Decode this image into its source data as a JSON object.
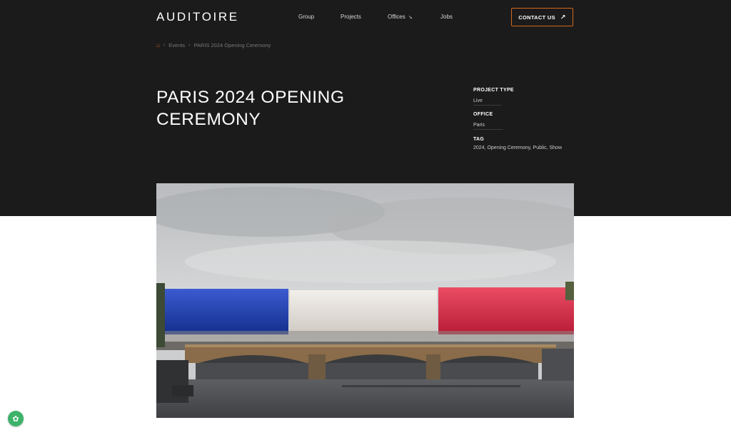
{
  "brand": {
    "logo": "AUDITOIRE"
  },
  "nav": {
    "items": [
      {
        "label": "Group"
      },
      {
        "label": "Projects"
      },
      {
        "label": "Offices",
        "icon": "arrow-down-right-icon"
      },
      {
        "label": "Jobs"
      }
    ],
    "contact_label": "CONTACT US",
    "contact_icon": "arrow-up-right-icon",
    "accent_color": "#d0681f"
  },
  "breadcrumb": {
    "home_icon": "home-icon",
    "items": [
      "Events",
      "PARIS 2024 Opening Ceremony"
    ]
  },
  "page": {
    "title": "PARIS 2024 OPENING CEREMONY"
  },
  "meta": {
    "project_type_label": "PROJECT TYPE",
    "project_type_value": "Live",
    "office_label": "OFFICE",
    "office_value": "Paris",
    "tag_label": "TAG",
    "tag_value": "2024, Opening Ceremony, Public, Show"
  },
  "hero_image": {
    "subject": "photo"
  },
  "cookie_badge": {
    "icon": "cookie-icon"
  },
  "colors": {
    "header_bg": "#1c1b1b",
    "flag_blue": "#1f3fa8",
    "flag_white": "#e9e6e2",
    "flag_red": "#d62a45"
  }
}
